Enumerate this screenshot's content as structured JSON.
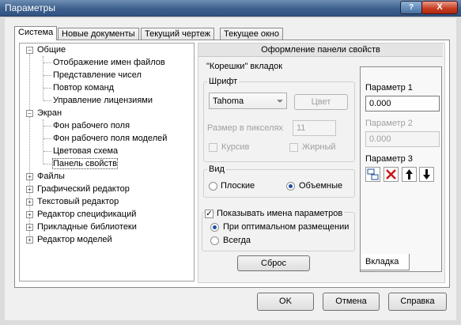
{
  "window": {
    "title": "Параметры",
    "help": "?",
    "close": "X"
  },
  "tabs": [
    "Система",
    "Новые документы",
    "Текущий чертеж",
    "Текущее окно"
  ],
  "tree": {
    "items": [
      "Общие",
      "Отображение имен файлов",
      "Представление чисел",
      "Повтор команд",
      "Управление лицензиями",
      "Экран",
      "Фон рабочего поля",
      "Фон рабочего поля моделей",
      "Цветовая схема",
      "Панель свойств",
      "Файлы",
      "Графический редактор",
      "Текстовый редактор",
      "Редактор спецификаций",
      "Прикладные библиотеки",
      "Редактор моделей"
    ],
    "selected": "Панель свойств"
  },
  "pane": {
    "header": "Оформление панели свойств",
    "tabs_group": "\"Корешки\" вкладок",
    "font_group": "Шрифт",
    "font_value": "Tahoma",
    "color_button": "Цвет",
    "size_label": "Размер в пикселях",
    "size_value": "11",
    "italic_label": "Курсив",
    "bold_label": "Жирный",
    "view_group": "Вид",
    "flat_label": "Плоские",
    "volume_label": "Объемные",
    "show_names_label": "Показывать имена параметров",
    "optimal_label": "При оптимальном размещении",
    "always_label": "Всегда",
    "reset_button": "Сброс"
  },
  "preview": {
    "param1_label": "Параметр 1",
    "param1_value": "0.000",
    "param2_label": "Параметр 2",
    "param2_value": "0.000",
    "param3_label": "Параметр 3",
    "tab_label": "Вкладка"
  },
  "buttons": {
    "ok": "OK",
    "cancel": "Отмена",
    "help": "Справка"
  }
}
